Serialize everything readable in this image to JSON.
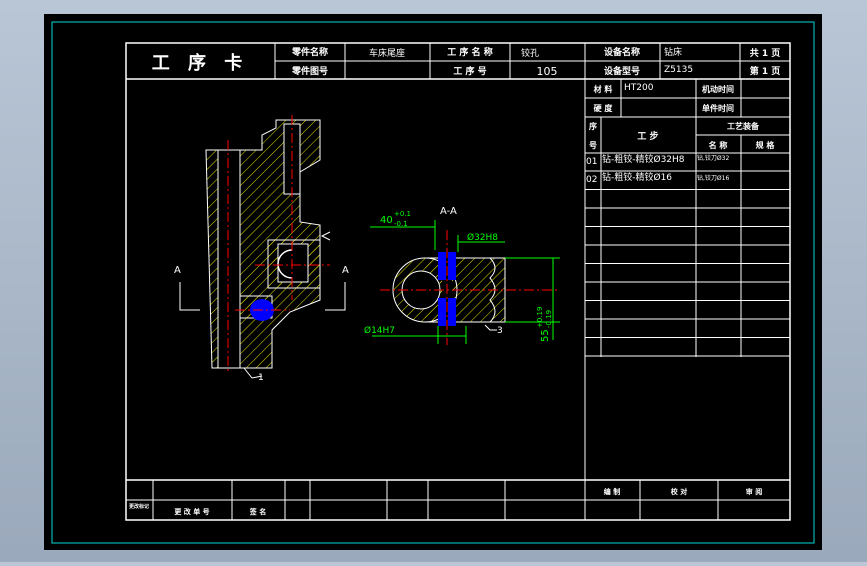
{
  "colors": {
    "background": "#000000",
    "frame": "#ffffff",
    "border": "#00d8d8",
    "green": "#00ff00",
    "red": "#ff0000",
    "blue": "#0000ff",
    "hatch": "#e0e000"
  },
  "header": {
    "title": "工 序 卡",
    "part_name_label": "零件名称",
    "part_name": "车床尾座",
    "part_no_label": "零件图号",
    "process_name_label": "工 序 名 称",
    "process_name": "铰孔",
    "process_no_label": "工 序 号",
    "process_no": "105",
    "equip_name_label": "设备名称",
    "equip_name": "钻床",
    "equip_model_label": "设备型号",
    "equip_model": "Z5135",
    "total_pages": "共 1 页",
    "page": "第 1 页"
  },
  "info": {
    "material_label": "材 料",
    "material": "HT200",
    "machine_time_label": "机动时间",
    "hardness_label": "硬 度",
    "unit_time_label": "单件时间",
    "seq_top": "序",
    "seq_bottom": "号",
    "step_label": "工 步",
    "equipment_label": "工艺装备",
    "name_label": "名 称",
    "spec_label": "规 格"
  },
  "steps": [
    {
      "no": "01",
      "desc": "钻-粗铰-精铰Ø32H8",
      "tool": "钻,铰刀Ø32"
    },
    {
      "no": "02",
      "desc": "钻-粗铰-精铰Ø16",
      "tool": "钻,铰刀Ø16"
    }
  ],
  "footer": {
    "change_mark": "更改标记",
    "change_no": "更 改 单 号",
    "signature": "签 名",
    "compile": "编 制",
    "check": "校 对",
    "review": "审 阅"
  },
  "drawing": {
    "section_label_left": "A",
    "section_label_right": "A",
    "section_title": "A-A",
    "leader_1": "1",
    "leader_3": "3",
    "dim_40": "40",
    "tol_40_upper": "+0.1",
    "tol_40_lower": "-0.1",
    "dim_32": "Ø32H8",
    "dim_14": "Ø14H7",
    "dim_55": "55",
    "tol_55_upper": "+0.19",
    "tol_55_lower": "-0.19"
  }
}
